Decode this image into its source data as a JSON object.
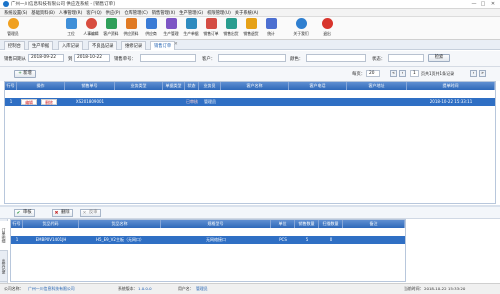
{
  "window": {
    "title": "广州一川信息科技有限公司 供应连系统 - [销售订单]",
    "min": "—",
    "max": "□",
    "close": "✕"
  },
  "menu": [
    "系统设置(S)",
    "基础资料(B)",
    "人事管理(R)",
    "客户(Q)",
    "供应(P)",
    "仓库管理(C)",
    "销售管理(X)",
    "生产管理(G)",
    "权限管理(U)",
    "关于系统(A)"
  ],
  "toolbar": [
    "管理员",
    "工位",
    "人事编辑",
    "客户资料",
    "供应资料",
    "供应商",
    "生产管理",
    "生产单据",
    "销售订单",
    "销售出货",
    "销售退货",
    "统计",
    "关于我们",
    "退出"
  ],
  "tabs": [
    "控制台",
    "生产单据",
    "入库记录",
    "不良品记录",
    "维修记录",
    "销售订单"
  ],
  "filter": {
    "date_label": "销售日期从",
    "date_from": "2018-09-22",
    "to_label": "到",
    "date_to": "2018-10-22",
    "no_label": "销售单号：",
    "cust_label": "客户：",
    "color_label": "颜色：",
    "state_label": "状态：",
    "search": "检索"
  },
  "list": {
    "add": "新增",
    "page_size_label": "每页：",
    "page_size": "20",
    "page": "1",
    "page_info": "页共1页共1条记录"
  },
  "grid": {
    "headers": [
      "行号",
      "操作",
      "销售单号",
      "业务类型",
      "单据类型",
      "状态",
      "业务员",
      "客户名称",
      "客户电话",
      "客户地址",
      "提单时间"
    ],
    "row": {
      "no": "1",
      "edit": "编辑",
      "del": "删除",
      "order": "XS201809001",
      "state": "已审核",
      "clerk": "管理员",
      "time": "2018-10-22 15:33:11"
    }
  },
  "actions": {
    "audit": "审核",
    "delete": "删除",
    "unaudit": "反审"
  },
  "side": [
    "订单明细",
    "出货记录"
  ],
  "detail": {
    "headers": [
      "行号",
      "货品代码",
      "货品名称",
      "规格型号",
      "单位",
      "销售数量",
      "扫描数量",
      "备注"
    ],
    "row": {
      "no": "1",
      "code": "EMBP0V1401JH",
      "name": "H5_E9_V2主板（无网口）",
      "spec": "无网络接口",
      "unit": "PCS",
      "qty": "5",
      "scan": "0"
    }
  },
  "status": {
    "company_label": "公司名称：",
    "company": "广州一川信息科技有限公司",
    "version_label": "系统版本：",
    "version": "1.0.0.0",
    "user_label": "用户名：",
    "user": "管理员",
    "time_label": "当前时间：",
    "time": "2018-10-22 15:33:20"
  }
}
